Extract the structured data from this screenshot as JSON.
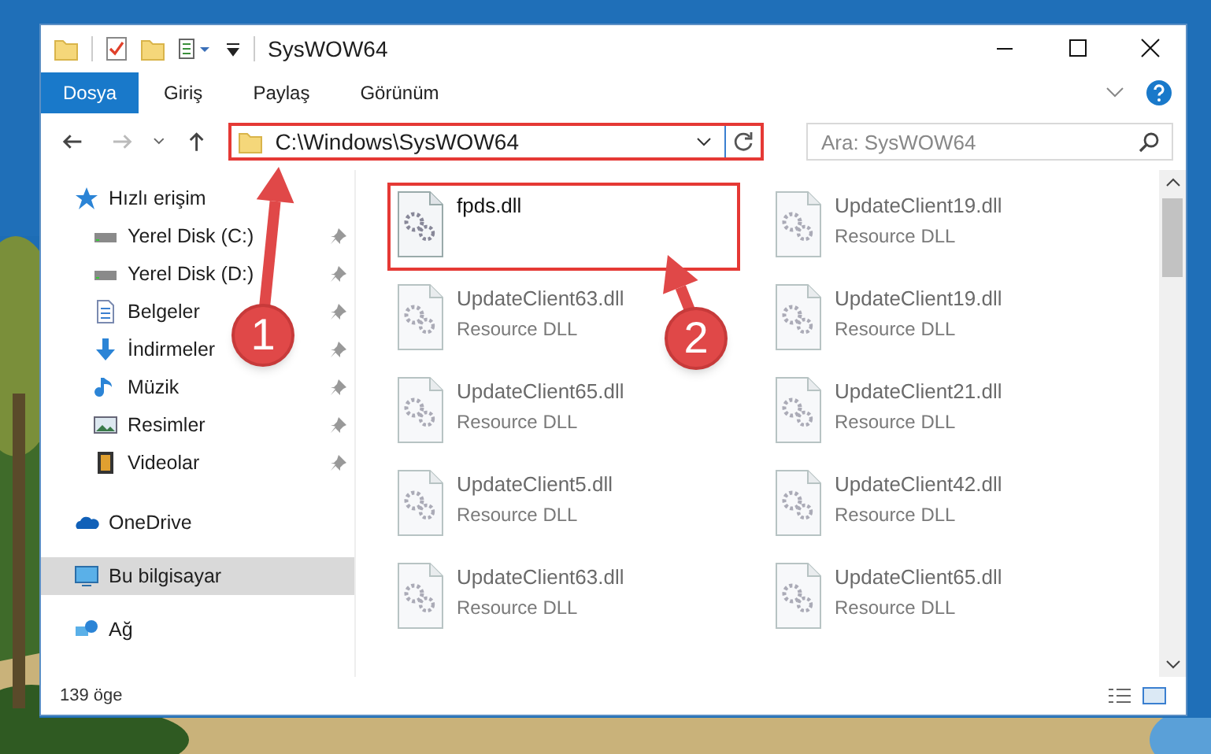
{
  "window": {
    "title": "SysWOW64"
  },
  "ribbon_tabs": [
    {
      "label": "Dosya",
      "selected": true
    },
    {
      "label": "Giriş",
      "selected": false
    },
    {
      "label": "Paylaş",
      "selected": false
    },
    {
      "label": "Görünüm",
      "selected": false
    }
  ],
  "address": {
    "path": "C:\\Windows\\SysWOW64",
    "highlighted": true
  },
  "search": {
    "placeholder": "Ara: SysWOW64"
  },
  "nav_pane": [
    {
      "label": "Hızlı erişim",
      "selected": false,
      "children": [
        {
          "label": "Yerel Disk (C:)",
          "pinned": true
        },
        {
          "label": "Yerel Disk (D:)",
          "pinned": true
        },
        {
          "label": "Belgeler",
          "pinned": true
        },
        {
          "label": "İndirmeler",
          "pinned": true
        },
        {
          "label": "Müzik",
          "pinned": true
        },
        {
          "label": "Resimler",
          "pinned": true
        },
        {
          "label": "Videolar",
          "pinned": true
        }
      ]
    },
    {
      "label": "OneDrive",
      "selected": false
    },
    {
      "label": "Bu bilgisayar",
      "selected": true
    },
    {
      "label": "Ağ",
      "selected": false
    }
  ],
  "files": [
    {
      "name": "fpds.dll",
      "highlighted": true
    },
    {
      "name": "UpdateClient19.dll",
      "subtitle": "Resource DLL",
      "highlighted": false
    },
    {
      "name": "UpdateClient63.dll",
      "subtitle": "Resource DLL",
      "highlighted": false
    },
    {
      "name": "UpdateClient19.dll",
      "subtitle": "Resource DLL",
      "highlighted": false
    },
    {
      "name": "UpdateClient65.dll",
      "subtitle": "Resource DLL",
      "highlighted": false
    },
    {
      "name": "UpdateClient21.dll",
      "subtitle": "Resource DLL",
      "highlighted": false
    },
    {
      "name": "UpdateClient5.dll",
      "subtitle": "Resource DLL",
      "highlighted": false
    },
    {
      "name": "UpdateClient42.dll",
      "subtitle": "Resource DLL",
      "highlighted": false
    },
    {
      "name": "UpdateClient63.dll",
      "subtitle": "Resource DLL",
      "highlighted": false
    },
    {
      "name": "UpdateClient65.dll",
      "subtitle": "Resource DLL",
      "highlighted": false
    }
  ],
  "status_bar": {
    "count": "139 öge"
  },
  "annotations": [
    {
      "label": "1"
    },
    {
      "label": "2"
    }
  ]
}
